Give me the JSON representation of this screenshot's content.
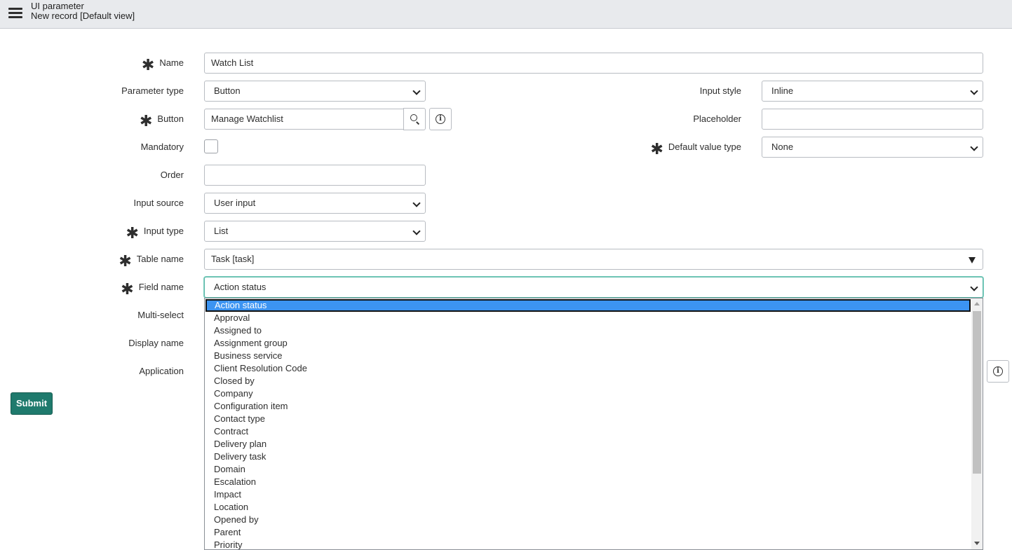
{
  "header": {
    "title": "UI parameter",
    "subtitle": "New record [Default view]"
  },
  "required_marker": "✱",
  "form": {
    "name": {
      "label": "Name",
      "value": "Watch List"
    },
    "parameter_type": {
      "label": "Parameter type",
      "value": "Button"
    },
    "input_style": {
      "label": "Input style",
      "value": "Inline"
    },
    "button": {
      "label": "Button",
      "value": "Manage Watchlist"
    },
    "placeholder": {
      "label": "Placeholder",
      "value": ""
    },
    "mandatory": {
      "label": "Mandatory",
      "checked": false
    },
    "default_value_type": {
      "label": "Default value type",
      "value": "None"
    },
    "order": {
      "label": "Order",
      "value": ""
    },
    "input_source": {
      "label": "Input source",
      "value": "User input"
    },
    "input_type": {
      "label": "Input type",
      "value": "List"
    },
    "table_name": {
      "label": "Table name",
      "value": "Task [task]"
    },
    "field_name": {
      "label": "Field name",
      "value": "Action status"
    },
    "multi_select": {
      "label": "Multi-select"
    },
    "display_name": {
      "label": "Display name"
    },
    "application": {
      "label": "Application"
    }
  },
  "submit_label": "Submit",
  "field_name_options": [
    "Action status",
    "Approval",
    "Assigned to",
    "Assignment group",
    "Business service",
    "Client Resolution Code",
    "Closed by",
    "Company",
    "Configuration item",
    "Contact type",
    "Contract",
    "Delivery plan",
    "Delivery task",
    "Domain",
    "Escalation",
    "Impact",
    "Location",
    "Opened by",
    "Parent",
    "Priority"
  ],
  "selected_option_index": 0,
  "colors": {
    "header_bg": "#e8eaed",
    "submit_bg": "#1f7a6d",
    "selected_option_bg": "#3c94f2",
    "focus_border": "#5ab7a6"
  }
}
